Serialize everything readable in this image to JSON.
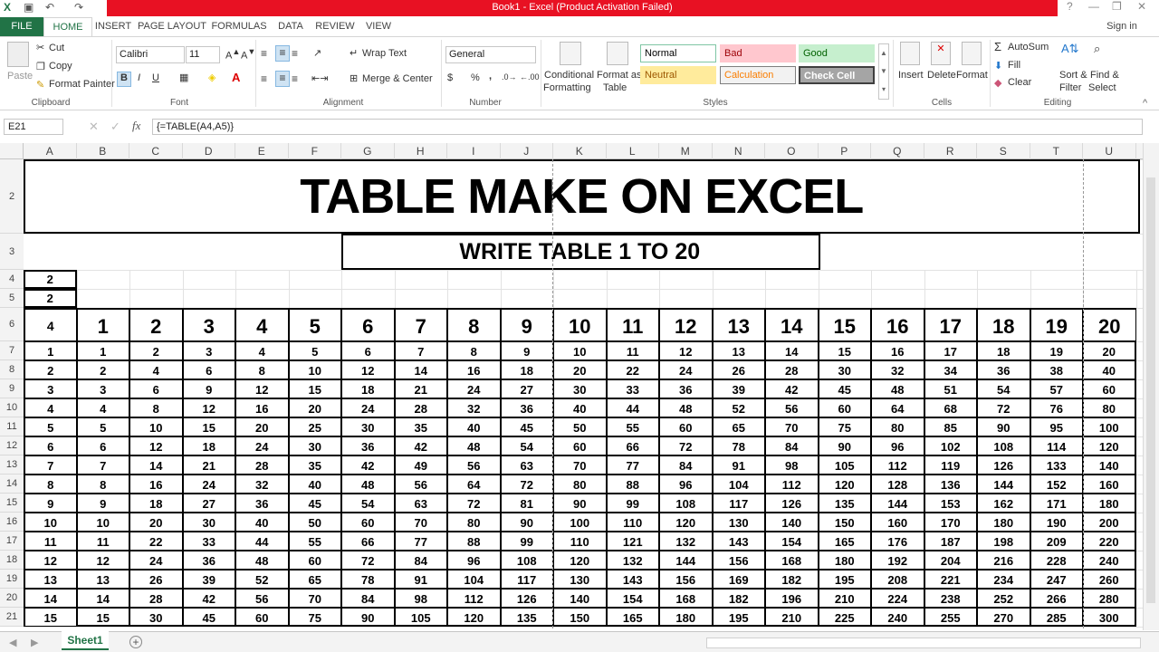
{
  "window": {
    "title": "Book1 - Excel (Product Activation Failed)",
    "sign_in": "Sign in",
    "help": "?",
    "minimize": "—",
    "restore": "❐",
    "close": "✕"
  },
  "tabs": [
    "FILE",
    "HOME",
    "INSERT",
    "PAGE LAYOUT",
    "FORMULAS",
    "DATA",
    "REVIEW",
    "VIEW"
  ],
  "ribbon": {
    "clipboard": {
      "paste": "Paste",
      "cut": "Cut",
      "copy": "Copy",
      "painter": "Format Painter",
      "group": "Clipboard"
    },
    "font": {
      "name": "Calibri",
      "size": "11",
      "bold": "B",
      "italic": "I",
      "underline": "U",
      "group": "Font"
    },
    "alignment": {
      "wrap": "Wrap Text",
      "merge": "Merge & Center",
      "group": "Alignment"
    },
    "number": {
      "format": "General",
      "percent": "%",
      "comma": ",",
      "group": "Number"
    },
    "styles_btns": {
      "conditional": "Conditional",
      "conditional2": "Formatting",
      "format_as": "Format as",
      "format_as2": "Table",
      "group": "Styles"
    },
    "styles": [
      {
        "label": "Normal",
        "bg": "#ffffff",
        "fg": "#000000",
        "border": "#7fc6a4"
      },
      {
        "label": "Bad",
        "bg": "#ffc7ce",
        "fg": "#9c0006",
        "border": "#ffc7ce"
      },
      {
        "label": "Good",
        "bg": "#c6efce",
        "fg": "#006100",
        "border": "#c6efce"
      },
      {
        "label": "Neutral",
        "bg": "#ffeb9c",
        "fg": "#9c5700",
        "border": "#ffeb9c"
      },
      {
        "label": "Calculation",
        "bg": "#f2f2f2",
        "fg": "#fa7d00",
        "border": "#7f7f7f"
      },
      {
        "label": "Check Cell",
        "bg": "#a5a5a5",
        "fg": "#ffffff",
        "border": "#3f3f3f"
      }
    ],
    "cells": {
      "insert": "Insert",
      "delete": "Delete",
      "format": "Format",
      "group": "Cells"
    },
    "editing": {
      "autosum": "AutoSum",
      "fill": "Fill",
      "clear": "Clear",
      "sort": "Sort &",
      "sort2": "Filter",
      "find": "Find &",
      "find2": "Select",
      "group": "Editing"
    }
  },
  "formula_bar": {
    "name_box": "E21",
    "formula": "{=TABLE(A4,A5)}",
    "fx": "fx"
  },
  "columns": [
    "A",
    "B",
    "C",
    "D",
    "E",
    "F",
    "G",
    "H",
    "I",
    "J",
    "K",
    "L",
    "M",
    "N",
    "O",
    "P",
    "Q",
    "R",
    "S",
    "T",
    "U"
  ],
  "rows": [
    "2",
    "3",
    "4",
    "5",
    "6",
    "7",
    "8",
    "9",
    "10",
    "11",
    "12",
    "13",
    "14",
    "15",
    "16",
    "17",
    "18",
    "19",
    "20",
    "21"
  ],
  "sheet": {
    "title": "TABLE MAKE ON EXCEL",
    "subtitle": "WRITE TABLE 1 TO 20",
    "a4": "2",
    "a5": "2",
    "a6": "4",
    "header": [
      "1",
      "2",
      "3",
      "4",
      "5",
      "6",
      "7",
      "8",
      "9",
      "10",
      "11",
      "12",
      "13",
      "14",
      "15",
      "16",
      "17",
      "18",
      "19",
      "20"
    ],
    "rowlabels": [
      "1",
      "2",
      "3",
      "4",
      "5",
      "6",
      "7",
      "8",
      "9",
      "10",
      "11",
      "12",
      "13",
      "14",
      "15"
    ]
  },
  "sheet_tab": "Sheet1",
  "add_sheet": "+"
}
